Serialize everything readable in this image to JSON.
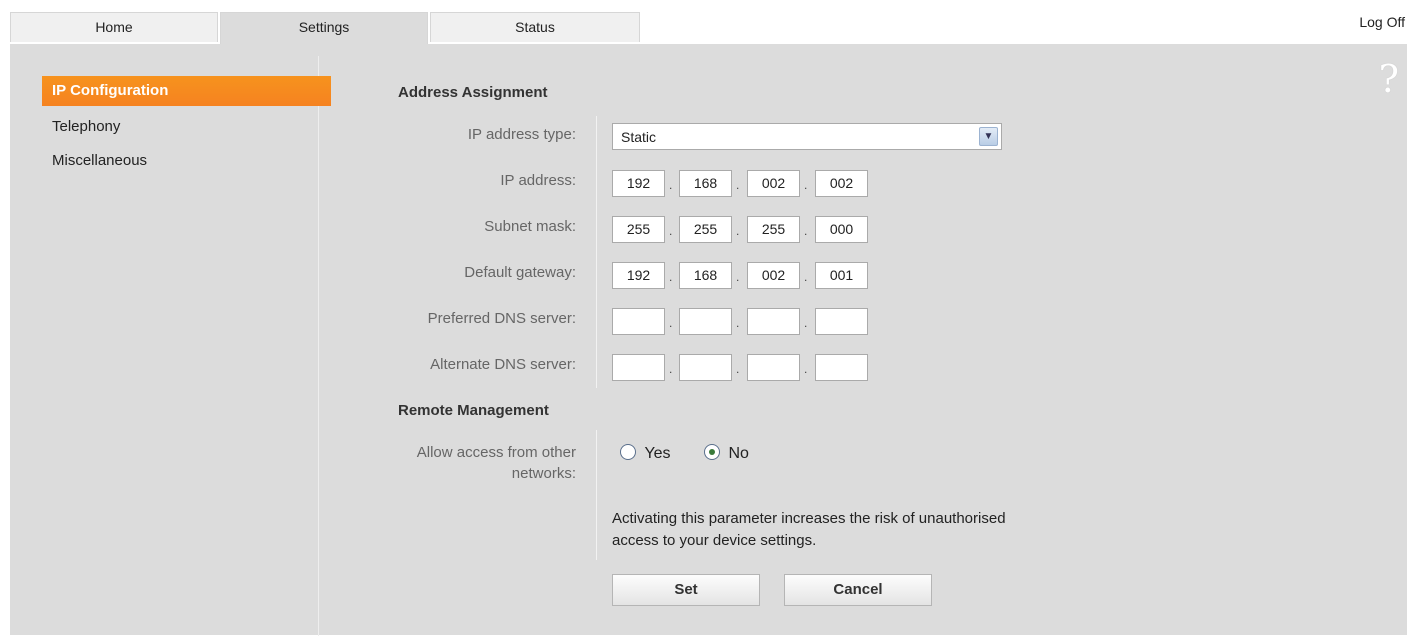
{
  "tabs": [
    {
      "label": "Home"
    },
    {
      "label": "Settings"
    },
    {
      "label": "Status"
    }
  ],
  "log_off": "Log Off",
  "help_icon": "?",
  "sidebar": {
    "items": [
      {
        "label": "IP Configuration",
        "active": true
      },
      {
        "label": "Telephony"
      },
      {
        "label": "Miscellaneous"
      }
    ]
  },
  "address_assignment": {
    "title": "Address Assignment",
    "ip_type": {
      "label": "IP address type:",
      "value": "Static"
    },
    "ip_address": {
      "label": "IP address:",
      "octets": [
        "192",
        "168",
        "002",
        "002"
      ]
    },
    "subnet_mask": {
      "label": "Subnet mask:",
      "octets": [
        "255",
        "255",
        "255",
        "000"
      ]
    },
    "default_gateway": {
      "label": "Default gateway:",
      "octets": [
        "192",
        "168",
        "002",
        "001"
      ]
    },
    "preferred_dns": {
      "label": "Preferred DNS server:",
      "octets": [
        "",
        "",
        "",
        ""
      ]
    },
    "alternate_dns": {
      "label": "Alternate DNS server:",
      "octets": [
        "",
        "",
        "",
        ""
      ]
    }
  },
  "remote_management": {
    "title": "Remote Management",
    "allow_label_line1": "Allow access from other",
    "allow_label_line2": "networks:",
    "options": {
      "yes": "Yes",
      "no": "No",
      "selected": "No"
    },
    "note_line1": "Activating this parameter increases the risk of unauthorised",
    "note_line2": "access to your device settings."
  },
  "buttons": {
    "set": "Set",
    "cancel": "Cancel"
  },
  "colors": {
    "accent": "#f58220",
    "panel": "#dcdcdc"
  }
}
